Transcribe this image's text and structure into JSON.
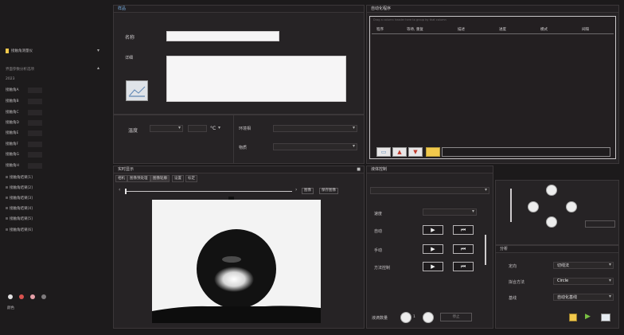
{
  "sidebar": {
    "device_label": "接触角测量仪",
    "section_label": "界面参数分析选项",
    "top_value": "2023",
    "params": [
      "接触角A",
      "接触角B",
      "接触角C",
      "接触角D",
      "接触角E",
      "接触角F",
      "接触角G",
      "接触角H"
    ],
    "results": [
      "接触角结果[1]",
      "接触角结果[2]",
      "接触角结果[3]",
      "接触角结果[4]",
      "接触角结果[5]",
      "接触角结果[6]"
    ],
    "bottom_label": "颜色"
  },
  "sample": {
    "header": "样品",
    "name_label": "名称",
    "desc_label": "详细",
    "name_value": "",
    "desc_value": ""
  },
  "environment": {
    "temp_label": "温度",
    "temp_unit": "°C",
    "env_label": "环境相",
    "material_label": "物质"
  },
  "auto": {
    "header": "自动化程序",
    "drag_hint": "Drag a column header here to group by that column",
    "columns": [
      "程序",
      "等待, 重复",
      "描述",
      "进度",
      "模式",
      "间隔"
    ]
  },
  "live": {
    "header": "实时显示",
    "tabs": [
      "相机",
      "图像预处理",
      "图像轮廓",
      "设置",
      "标定"
    ],
    "capture_btn": "图像",
    "save_btn": "保存图像"
  },
  "device_control": {
    "header": "液体控制",
    "rows": [
      "速度",
      "自动",
      "手动",
      "方法控制"
    ],
    "dosing_label": "液滴数量",
    "stop_label": "停止",
    "dosing_value": "1"
  },
  "analysis": {
    "header": "分析",
    "method_label": "定向",
    "method_value": "切线法",
    "fit_label": "拟合方法",
    "fit_value": "Circle",
    "baseline_label": "基线",
    "baseline_value": "自动化基线"
  },
  "icons": [
    "monitor-icon",
    "up-arrow-icon",
    "down-arrow-icon",
    "folder-icon",
    "play-icon",
    "skip-back-icon"
  ],
  "colors": {
    "accent": "#f2c94c",
    "red": "#d9534f",
    "green": "#7ac143"
  }
}
